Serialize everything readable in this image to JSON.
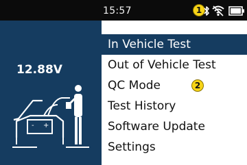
{
  "status_bar": {
    "time": "15:57",
    "markers": [
      "1"
    ],
    "icons": [
      "bluetooth-icon",
      "wifi-icon",
      "battery-icon"
    ]
  },
  "left_panel": {
    "voltage": "12.88V",
    "illustration": "car-battery-test-icon",
    "background_color": "#153c60"
  },
  "menu": {
    "items": [
      {
        "label": "In Vehicle Test",
        "selected": true
      },
      {
        "label": "Out of Vehicle Test",
        "selected": false
      },
      {
        "label": "QC Mode",
        "selected": false
      },
      {
        "label": "Test History",
        "selected": false
      },
      {
        "label": "Software Update",
        "selected": false
      },
      {
        "label": "Settings",
        "selected": false
      }
    ],
    "marker": "2",
    "selected_color": "#153c60"
  }
}
